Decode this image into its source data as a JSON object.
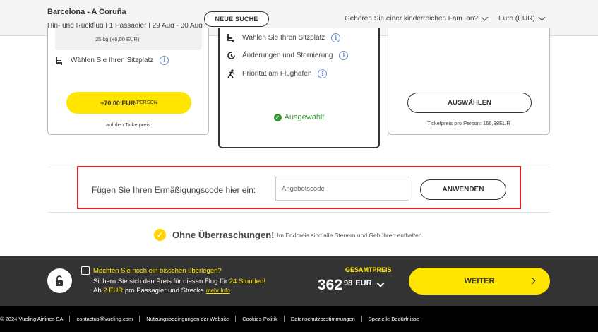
{
  "header": {
    "route": "Barcelona - A Coruña",
    "details": "Hin- und Rückflug | 1 Passagier | 29 Aug - 30 Aug",
    "new_search": "NEUE SUCHE",
    "large_family": "Gehören Sie einer kinderreichen Fam. an?",
    "currency": "Euro (EUR)"
  },
  "fares": {
    "left": {
      "baggage": "25 kg (+6,00 EUR)",
      "seat": "Wählen Sie Ihren Sitzplatz",
      "price": "+70,00 EUR",
      "price_unit": "/PERSON",
      "subtext": "auf den Ticketpreis"
    },
    "middle": {
      "features": [
        "Wählen Sie Ihren Sitzplatz",
        "Änderungen und Stornierung",
        "Priorität am Flughafen"
      ],
      "status": "Ausgewählt"
    },
    "right": {
      "select": "AUSWÄHLEN",
      "subtext": "Ticketpreis pro Person: 166,98EUR"
    }
  },
  "promo": {
    "label": "Fügen Sie Ihren Ermäßigungscode hier ein:",
    "placeholder": "Angebotscode",
    "apply": "ANWENDEN"
  },
  "no_surprises": {
    "bold": "Ohne Überraschungen!",
    "text": "Im Endpreis sind alle Steuern und Gebühren enthalten."
  },
  "bottom_bar": {
    "hold_title": "Möchten Sie noch ein bisschen überlegen?",
    "hold_line1_a": "Sichern Sie sich den Preis für diesen Flug für ",
    "hold_line1_b": "24 Stunden!",
    "hold_line2_a": "Ab ",
    "hold_line2_b": "2 EUR",
    "hold_line2_c": " pro Passagier und Strecke",
    "more_info": "mehr Info",
    "total_label": "GESAMTPREIS",
    "total_int": "362",
    "total_dec": "98",
    "total_currency": "EUR",
    "continue": "WEITER"
  },
  "footer": {
    "items": [
      "© 2024 Vueling Airlines SA",
      "contactus@vueling.com",
      "Nutzungsbedingungen der Website",
      "Cookies-Politik",
      "Datenschutzbestimmungen",
      "Spezielle Bedürfnisse"
    ]
  },
  "colors": {
    "accent_yellow": "#ffe500",
    "promo_border": "#e3202a",
    "selected_green": "#3a9a3a",
    "bar_dark": "#333333"
  }
}
